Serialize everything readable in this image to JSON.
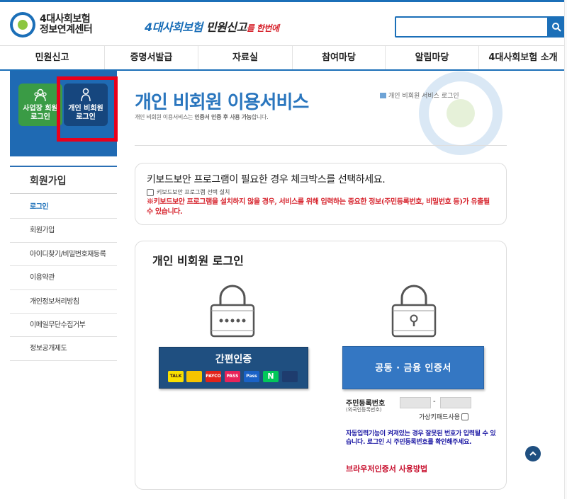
{
  "header": {
    "logo_line1": "4대사회보험",
    "logo_line2": "정보연계센터",
    "slogan_part1": "4대사회보험",
    "slogan_part2": "민원신고",
    "slogan_part3": "를 한번에",
    "search_placeholder": ""
  },
  "nav": {
    "items": [
      "민원신고",
      "증명서발급",
      "자료실",
      "참여마당",
      "알림마당",
      "4대사회보험 소개"
    ]
  },
  "login_panel": {
    "biz_label_1": "사업장 회원",
    "biz_label_2": "로그인",
    "ind_label_1": "개인 비회원",
    "ind_label_2": "로그인"
  },
  "sidebar": {
    "title": "회원가입",
    "items": [
      "로그인",
      "회원가입",
      "아이디찾기/비밀번호재등록",
      "이용약관",
      "개인정보처리방침",
      "이메일무단수집거부",
      "정보공개제도"
    ],
    "active_index": 0
  },
  "content": {
    "title": "개인 비회원 이용서비스",
    "subtitle_prefix": "개인 비회원 이용서비스는 ",
    "subtitle_bold": "인증서 인증 후 사용 가능",
    "subtitle_suffix": "합니다.",
    "breadcrumb": "개인 비회원 서비스 로그인"
  },
  "keyboard": {
    "title": "키보드보안 프로그램이 필요한 경우 체크박스를 선택하세요.",
    "checkbox_label": "키보드보안 프로그램 선택 설치",
    "warning": "※키보드보안 프로그램을 설치하지 않을 경우, 서비스를 위해 입력하는 중요한 정보(주민등록번호, 비밀번호 등)가 유출될 수 있습니다."
  },
  "login": {
    "title": "개인 비회원 로그인",
    "simple_auth_label": "간편인증",
    "providers": [
      "TALK",
      "",
      "PAYCO",
      "PASS",
      "Pass",
      "N",
      ""
    ],
    "cert_button": "공동 · 금융 인증서",
    "rrn_label": "주민등록번호",
    "rrn_sub": "(외국인등록번호)",
    "rrn_dash": "-",
    "virtual_keypad": "가상키패드사용",
    "auto_warning": "자동입력기능이 켜져있는 경우 잘못된 번호가 입력될 수 있습니다. 로그인 시 주민등록번호를 확인해주세요.",
    "howto_link": "브라우저인증서 사용방법"
  },
  "colors": {
    "primary": "#1b6fb8",
    "title_blue": "#2a76be",
    "warn_red": "#d7262f",
    "highlight_red": "#e8001c",
    "biz_green": "#3a9b45",
    "ind_navy": "#16467e",
    "simple_auth_bg": "#1f4f80",
    "cert_btn_bg": "#3477c3",
    "auto_warn_text": "#1a16a3"
  }
}
